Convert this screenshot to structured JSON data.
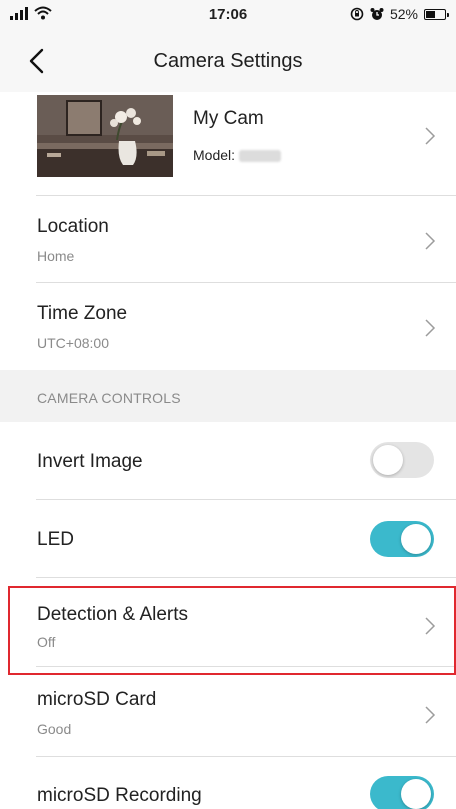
{
  "status_bar": {
    "time": "17:06",
    "battery_percent": "52%",
    "battery_level": 0.52,
    "icons": [
      "signal-icon",
      "wifi-icon",
      "screen-lock-icon",
      "alarm-icon",
      "battery-icon"
    ]
  },
  "nav": {
    "title": "Camera Settings",
    "back_icon": "chevron-left-icon"
  },
  "camera": {
    "name": "My Cam",
    "model_label": "Model:"
  },
  "rows": {
    "location": {
      "title": "Location",
      "value": "Home"
    },
    "time_zone": {
      "title": "Time Zone",
      "value": "UTC+08:00"
    }
  },
  "section": {
    "camera_controls": "CAMERA CONTROLS"
  },
  "controls": {
    "invert_image": {
      "title": "Invert Image",
      "enabled": false
    },
    "led": {
      "title": "LED",
      "enabled": true
    },
    "detection_alerts": {
      "title": "Detection & Alerts",
      "value": "Off",
      "highlighted": true
    },
    "microsd_card": {
      "title": "microSD Card",
      "value": "Good"
    },
    "microsd_recording": {
      "title": "microSD Recording",
      "enabled": true
    }
  },
  "colors": {
    "toggle_on": "#3bb9cc",
    "toggle_off": "#e4e4e4",
    "highlight": "#e0282f"
  }
}
